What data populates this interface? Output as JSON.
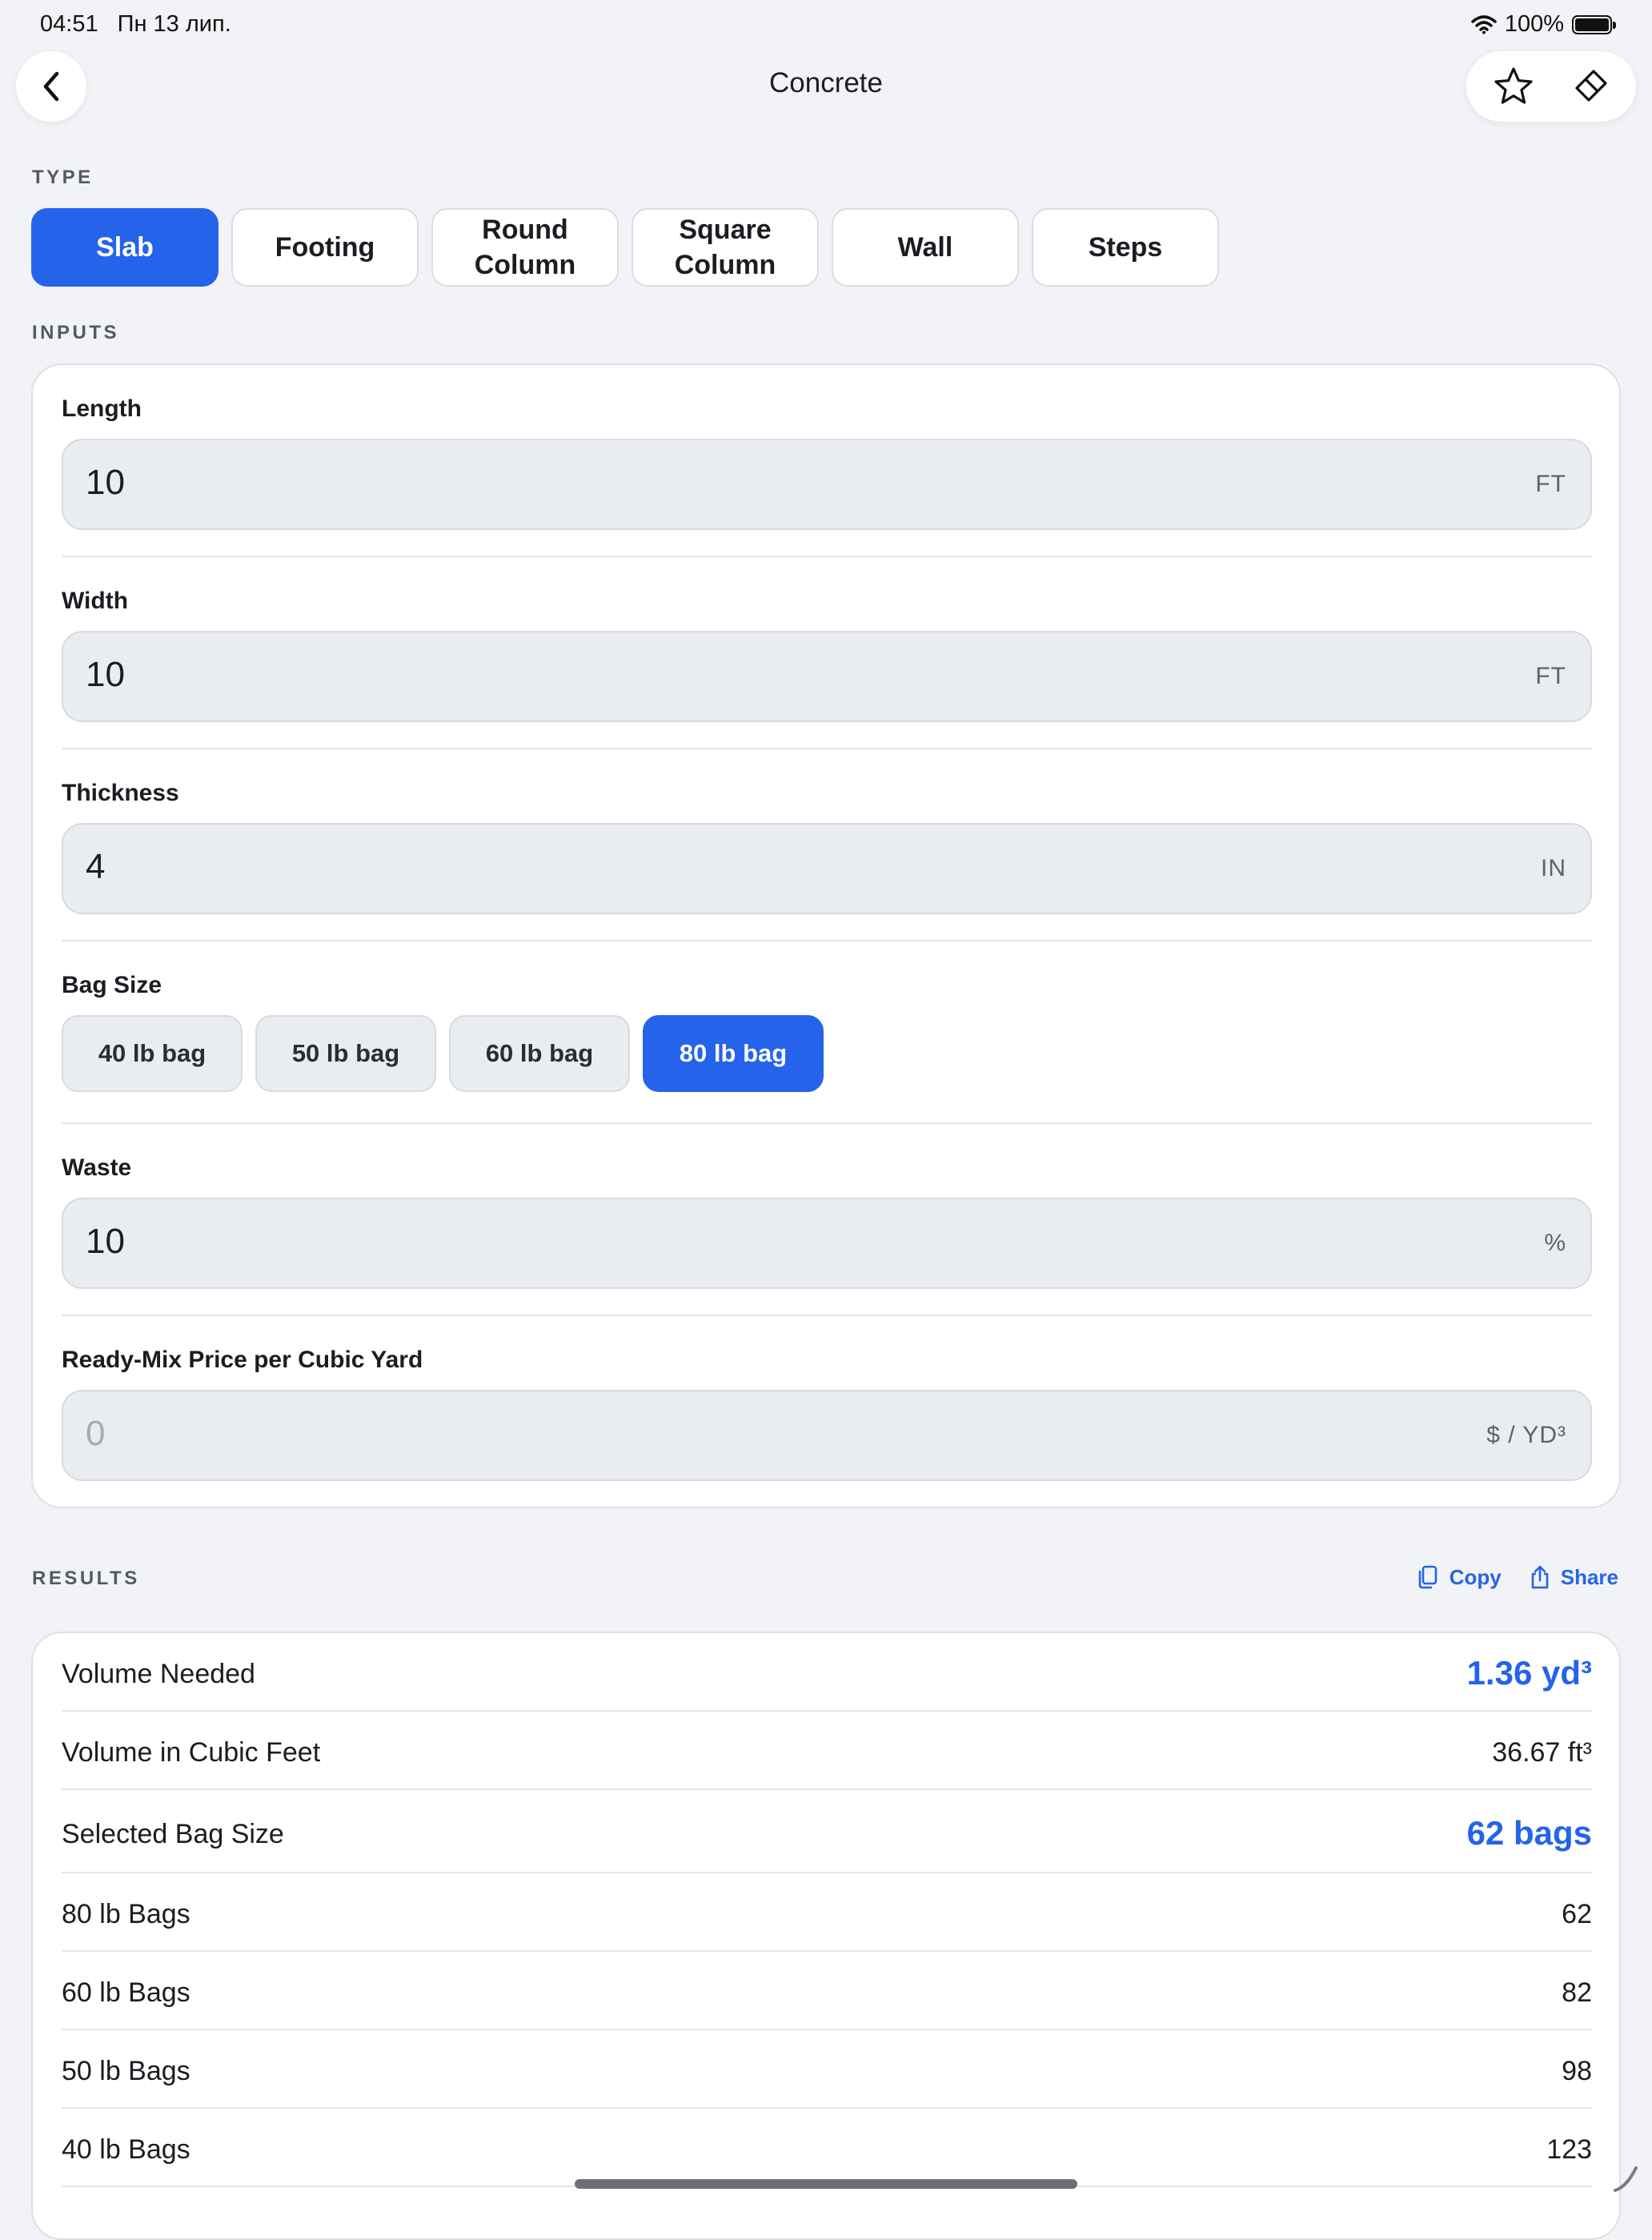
{
  "status": {
    "time": "04:51",
    "date": "Пн 13 лип.",
    "battery": "100%"
  },
  "nav": {
    "title": "Concrete",
    "back_icon": "chevron-left-icon",
    "favorite_icon": "star-icon",
    "clear_icon": "eraser-icon"
  },
  "type": {
    "label": "TYPE",
    "options": [
      "Slab",
      "Footing",
      "Round\nColumn",
      "Square\nColumn",
      "Wall",
      "Steps"
    ],
    "selected": "Slab"
  },
  "inputs": {
    "label": "INPUTS",
    "length": {
      "label": "Length",
      "value": "10",
      "unit": "FT"
    },
    "width": {
      "label": "Width",
      "value": "10",
      "unit": "FT"
    },
    "thickness": {
      "label": "Thickness",
      "value": "4",
      "unit": "IN"
    },
    "bag_size": {
      "label": "Bag Size",
      "options": [
        "40 lb bag",
        "50 lb bag",
        "60 lb bag",
        "80 lb bag"
      ],
      "selected": "80 lb bag"
    },
    "waste": {
      "label": "Waste",
      "value": "10",
      "unit": "%"
    },
    "price": {
      "label": "Ready-Mix Price per Cubic Yard",
      "placeholder": "0",
      "unit": "$ / YD³"
    }
  },
  "results": {
    "label": "RESULTS",
    "copy_label": "Copy",
    "share_label": "Share",
    "rows": [
      {
        "label": "Volume Needed",
        "value": "1.36 yd³"
      },
      {
        "label": "Volume in Cubic Feet",
        "value": "36.67 ft³"
      },
      {
        "label": "Selected Bag Size",
        "value": "62 bags"
      },
      {
        "label": "80 lb Bags",
        "value": "62"
      },
      {
        "label": "60 lb Bags",
        "value": "82"
      },
      {
        "label": "50 lb Bags",
        "value": "98"
      },
      {
        "label": "40 lb Bags",
        "value": "123"
      }
    ]
  },
  "colors": {
    "accent": "#2563eb",
    "background": "#f2f3f7",
    "field": "#e9ecf0"
  }
}
